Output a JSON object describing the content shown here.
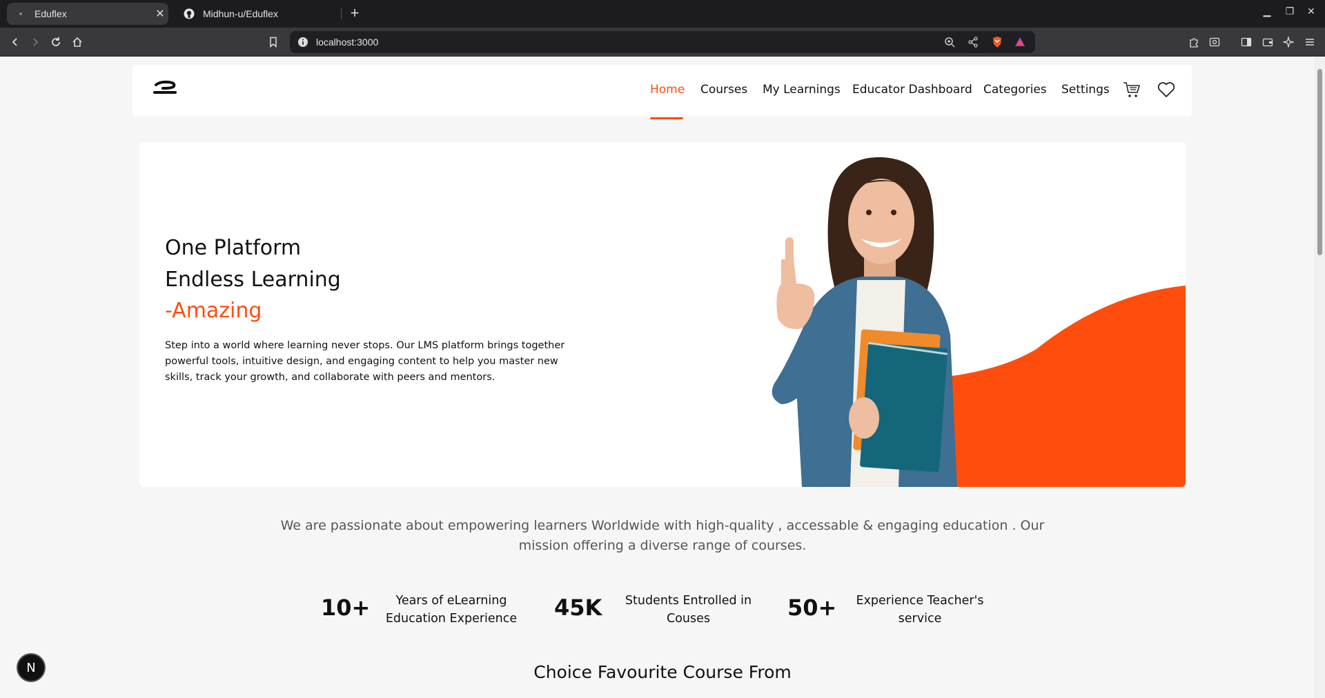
{
  "browser": {
    "tabs": [
      {
        "title": "Eduflex",
        "active": true
      },
      {
        "title": "Midhun-u/Eduflex",
        "active": false
      }
    ],
    "url": "localhost:3000"
  },
  "nav": {
    "items": [
      "Home",
      "Courses",
      "My Learnings",
      "Educator Dashboard",
      "Categories",
      "Settings"
    ],
    "active": "Home",
    "accent": "#ff4d0d"
  },
  "hero": {
    "line1": "One Platform",
    "line2": "Endless Learning",
    "line3": "-Amazing",
    "description": "Step into a world where learning never stops. Our LMS platform brings together powerful tools, intuitive design, and engaging content to help you master new skills, track your growth, and collaborate with peers and mentors."
  },
  "mission": "We are passionate about empowering learners Worldwide with high-quality , accessable & engaging education . Our mission offering a diverse range of courses.",
  "stats": [
    {
      "value": "10+",
      "label": "Years of eLearning Education Experience"
    },
    {
      "value": "45K",
      "label": "Students Entrolled in Couses"
    },
    {
      "value": "50+",
      "label": "Experience Teacher's service"
    }
  ],
  "section_title": "Choice Favourite Course From",
  "dev_badge": "N"
}
